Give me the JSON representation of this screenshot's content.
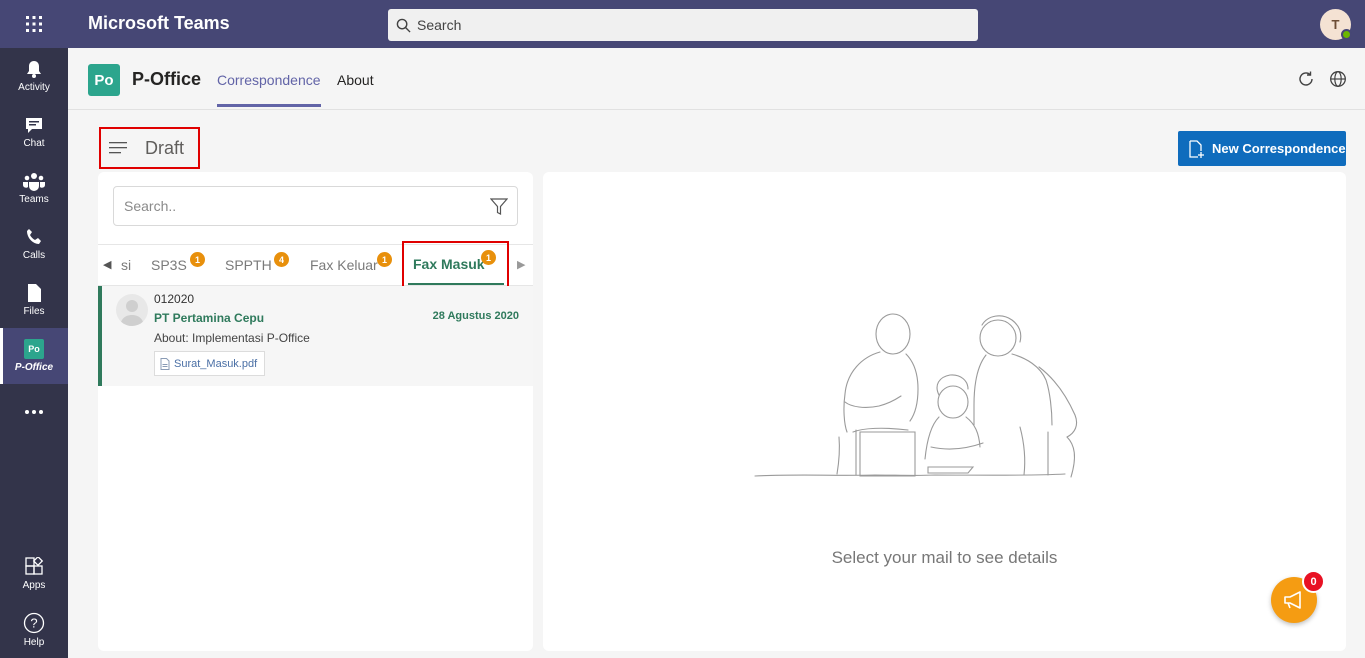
{
  "topbar": {
    "app_title": "Microsoft Teams",
    "search_placeholder": "Search",
    "avatar_initial": "T",
    "bg_color": "#464775"
  },
  "rail": {
    "items": [
      {
        "label": "Activity",
        "icon": "bell-icon"
      },
      {
        "label": "Chat",
        "icon": "chat-icon"
      },
      {
        "label": "Teams",
        "icon": "teams-icon"
      },
      {
        "label": "Calls",
        "icon": "phone-icon"
      },
      {
        "label": "Files",
        "icon": "file-icon"
      },
      {
        "label": "P-Office",
        "icon": "poffice-icon",
        "active": true
      },
      {
        "label": "",
        "icon": "more-icon"
      },
      {
        "label": "Apps",
        "icon": "apps-icon"
      },
      {
        "label": "Help",
        "icon": "help-icon"
      }
    ]
  },
  "app": {
    "logo_text": "Po",
    "name": "P-Office",
    "tabs": [
      {
        "label": "Correspondence",
        "active": true
      },
      {
        "label": "About",
        "active": false
      }
    ],
    "accent": "#6264a7"
  },
  "content": {
    "section_title": "Draft",
    "new_button": "New Correspondence",
    "search_placeholder": "Search..",
    "tabs": [
      {
        "label": "si",
        "badge": ""
      },
      {
        "label": "SP3S",
        "badge": "1"
      },
      {
        "label": "SPPTH",
        "badge": "4"
      },
      {
        "label": "Fax Keluar",
        "badge": "1"
      },
      {
        "label": "Fax Masuk",
        "badge": "1",
        "selected": true
      }
    ],
    "mail": {
      "id": "012020",
      "sender": "PT Pertamina Cepu",
      "date": "28 Agustus 2020",
      "about": "About: Implementasi P-Office",
      "attachment": "Surat_Masuk.pdf"
    },
    "empty_message": "Select your mail to see details",
    "fab_count": "0"
  }
}
